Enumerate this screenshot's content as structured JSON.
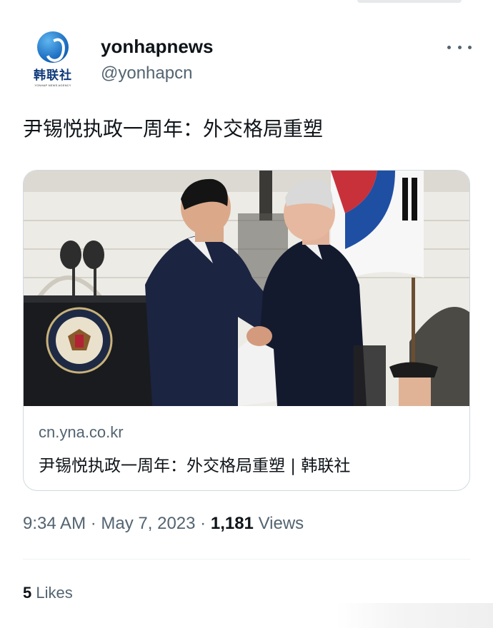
{
  "author": {
    "display_name": "yonhapnews",
    "handle": "@yonhapcn",
    "avatar_text": "韩联社",
    "avatar_subtext": "YONHAP NEWS AGENCY"
  },
  "tweet": {
    "text": "尹锡悦执政一周年：外交格局重塑"
  },
  "card": {
    "domain": "cn.yna.co.kr",
    "title": "尹锡悦执政一周年：外交格局重塑 | 韩联社"
  },
  "meta": {
    "time": "9:34 AM",
    "separator": "·",
    "date": "May 7, 2023",
    "views_count": "1,181",
    "views_label": "Views"
  },
  "stats": {
    "likes_count": "5",
    "likes_label": "Likes"
  },
  "icons": {
    "more": "more-horizontal-icon"
  },
  "colors": {
    "primary_text": "#0f1419",
    "secondary_text": "#536471",
    "border": "#cfd9de"
  }
}
